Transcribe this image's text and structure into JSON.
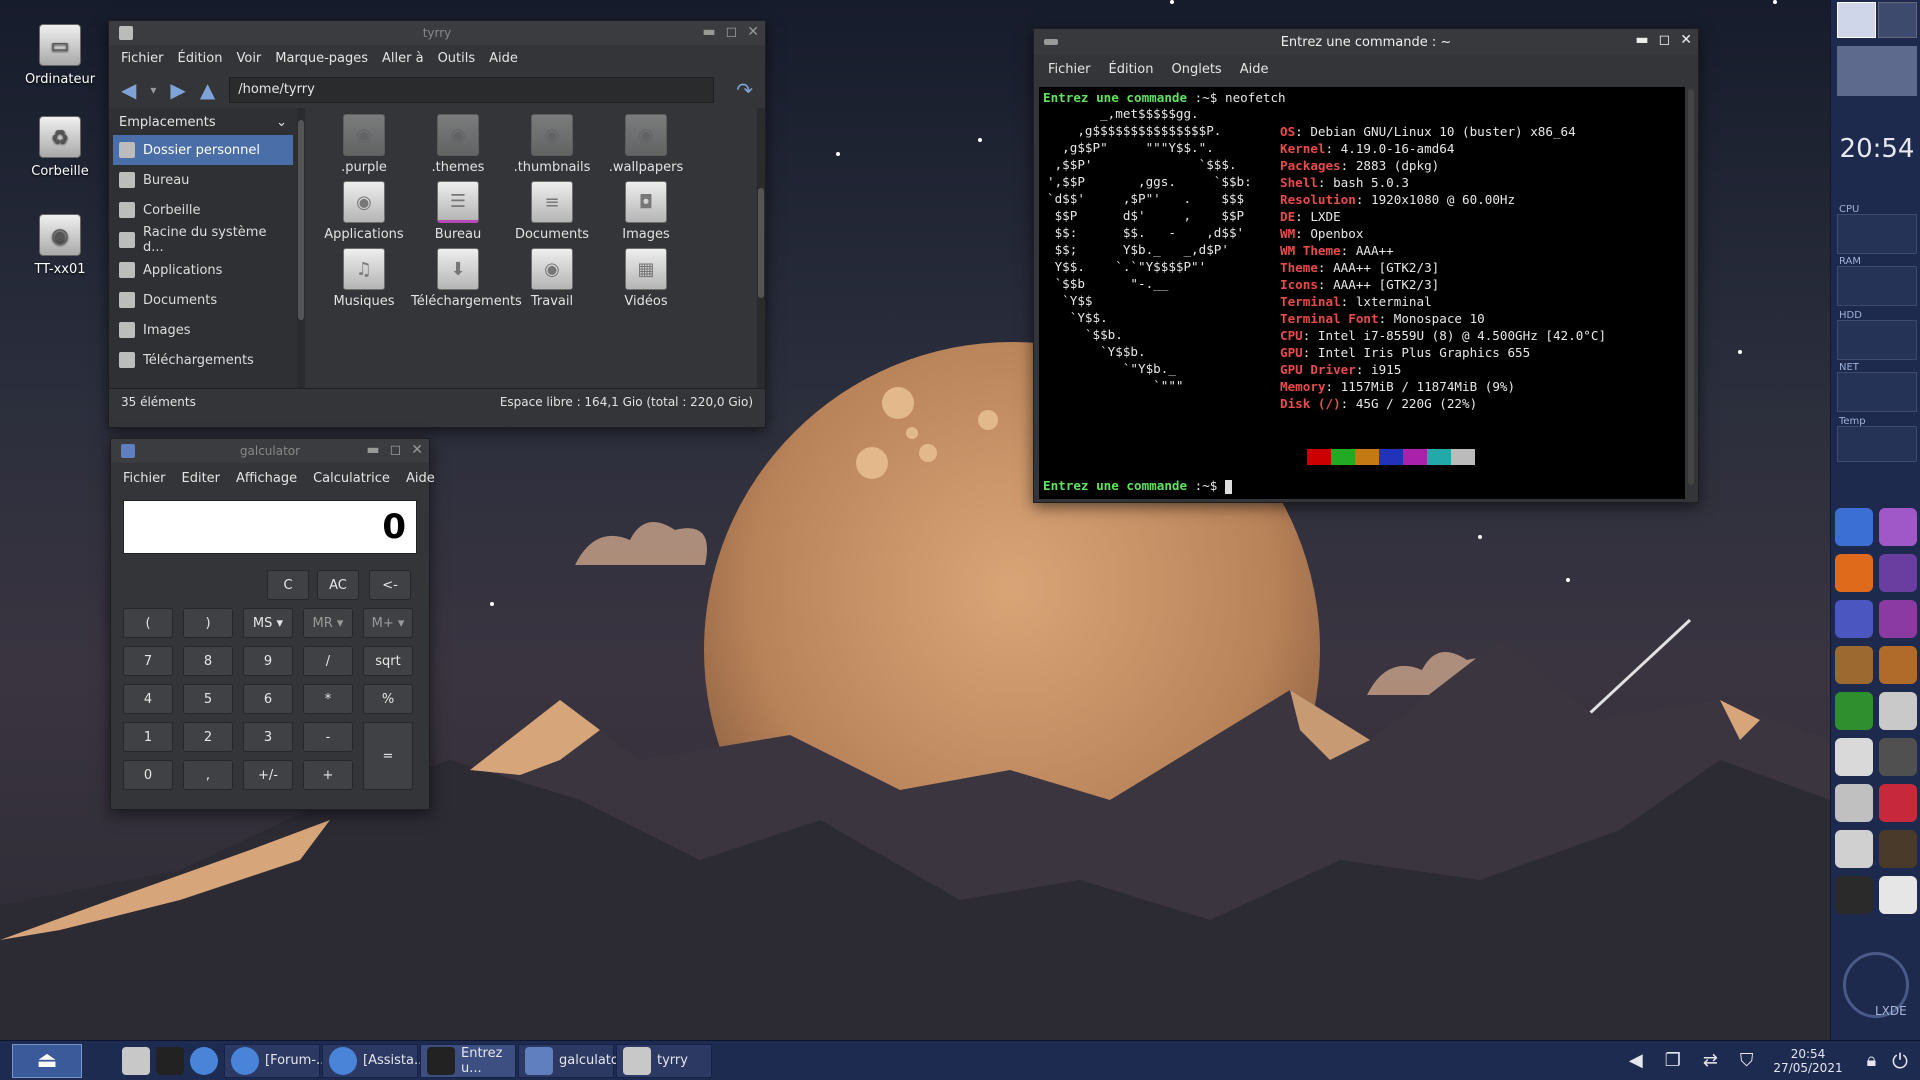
{
  "desktop_icons": [
    {
      "label": "Ordinateur",
      "icon": "computer-icon"
    },
    {
      "label": "Corbeille",
      "icon": "trash-icon"
    },
    {
      "label": "TT-xx01",
      "icon": "drive-icon"
    }
  ],
  "file_manager": {
    "title": "tyrry",
    "menu": [
      "Fichier",
      "Édition",
      "Voir",
      "Marque-pages",
      "Aller à",
      "Outils",
      "Aide"
    ],
    "path": "/home/tyrry",
    "sidebar_header": "Emplacements",
    "sidebar_items": [
      {
        "label": "Dossier personnel",
        "selected": true
      },
      {
        "label": "Bureau",
        "selected": false
      },
      {
        "label": "Corbeille",
        "selected": false
      },
      {
        "label": "Racine du système d...",
        "selected": false
      },
      {
        "label": "Applications",
        "selected": false
      },
      {
        "label": "Documents",
        "selected": false
      },
      {
        "label": "Images",
        "selected": false
      },
      {
        "label": "Téléchargements",
        "selected": false
      }
    ],
    "files": [
      {
        "name": ".purple",
        "hidden": true
      },
      {
        "name": ".themes",
        "hidden": true
      },
      {
        "name": ".thumbnails",
        "hidden": true
      },
      {
        "name": ".wallpapers",
        "hidden": true
      },
      {
        "name": "Applications",
        "hidden": false
      },
      {
        "name": "Bureau",
        "hidden": false
      },
      {
        "name": "Documents",
        "hidden": false
      },
      {
        "name": "Images",
        "hidden": false
      },
      {
        "name": "Musiques",
        "hidden": false
      },
      {
        "name": "Téléchargements",
        "hidden": false
      },
      {
        "name": "Travail",
        "hidden": false
      },
      {
        "name": "Vidéos",
        "hidden": false
      }
    ],
    "status_left": "35 éléments",
    "status_right": "Espace libre : 164,1 Gio (total : 220,0 Gio)"
  },
  "calculator": {
    "title": "galculator",
    "menu": [
      "Fichier",
      "Editer",
      "Affichage",
      "Calculatrice",
      "Aide"
    ],
    "display": "0",
    "buttons": [
      {
        "label": "C"
      },
      {
        "label": "AC"
      },
      {
        "label": "<-"
      },
      {
        "label": "("
      },
      {
        "label": ")"
      },
      {
        "label": "MS ▾"
      },
      {
        "label": "MR ▾"
      },
      {
        "label": "M+ ▾"
      },
      {
        "label": "7"
      },
      {
        "label": "8"
      },
      {
        "label": "9"
      },
      {
        "label": "/"
      },
      {
        "label": "sqrt"
      },
      {
        "label": "4"
      },
      {
        "label": "5"
      },
      {
        "label": "6"
      },
      {
        "label": "*"
      },
      {
        "label": "%"
      },
      {
        "label": "1"
      },
      {
        "label": "2"
      },
      {
        "label": "3"
      },
      {
        "label": "-"
      },
      {
        "label": "="
      },
      {
        "label": "0"
      },
      {
        "label": ","
      },
      {
        "label": "+/-"
      },
      {
        "label": "+"
      }
    ]
  },
  "terminal": {
    "title": "Entrez une commande : ~",
    "menu": [
      "Fichier",
      "Édition",
      "Onglets",
      "Aide"
    ],
    "prompt_user": "Entrez une commande",
    "prompt_path": " :~$ ",
    "command": "neofetch",
    "logo_lines": [
      "       _,met$$$$$gg.",
      "    ,g$$$$$$$$$$$$$$$P.",
      "  ,g$$P\"     \"\"\"Y$$.\".",
      " ,$$P'              `$$$.",
      "',$$P       ,ggs.     `$$b:",
      "`d$$'     ,$P\"'   .    $$$",
      " $$P      d$'     ,    $$P",
      " $$:      $$.   -    ,d$$'",
      " $$;      Y$b._   _,d$P'",
      " Y$$.    `.`\"Y$$$$P\"'",
      " `$$b      \"-.__",
      "  `Y$$",
      "   `Y$$.",
      "     `$$b.",
      "       `Y$$b.",
      "          `\"Y$b._",
      "              `\"\"\""
    ],
    "info": [
      {
        "key": "OS",
        "value": "Debian GNU/Linux 10 (buster) x86_64"
      },
      {
        "key": "Kernel",
        "value": "4.19.0-16-amd64"
      },
      {
        "key": "Packages",
        "value": "2883 (dpkg)"
      },
      {
        "key": "Shell",
        "value": "bash 5.0.3"
      },
      {
        "key": "Resolution",
        "value": "1920x1080 @ 60.00Hz"
      },
      {
        "key": "DE",
        "value": "LXDE"
      },
      {
        "key": "WM",
        "value": "Openbox"
      },
      {
        "key": "WM Theme",
        "value": "AAA++"
      },
      {
        "key": "Theme",
        "value": "AAA++ [GTK2/3]"
      },
      {
        "key": "Icons",
        "value": "AAA++ [GTK2/3]"
      },
      {
        "key": "Terminal",
        "value": "lxterminal"
      },
      {
        "key": "Terminal Font",
        "value": "Monospace 10"
      },
      {
        "key": "CPU",
        "value": "Intel i7-8559U (8) @ 4.500GHz [42.0°C]"
      },
      {
        "key": "GPU",
        "value": "Intel Iris Plus Graphics 655"
      },
      {
        "key": "GPU Driver",
        "value": "i915"
      },
      {
        "key": "Memory",
        "value": "1157MiB / 11874MiB (9%)"
      },
      {
        "key": "Disk (/)",
        "value": "45G / 220G (22%)"
      }
    ],
    "palette": [
      "#cc0000",
      "#22aa22",
      "#c47a12",
      "#2233bb",
      "#aa22aa",
      "#22aaaa",
      "#bbbbbb"
    ]
  },
  "dock": {
    "clock": "20:54",
    "monitors": [
      "CPU",
      "RAM",
      "HDD",
      "NET",
      "Temp"
    ],
    "logo_text": "LXDE",
    "apps": [
      {
        "icon": "chromium-icon",
        "color": "#3b6fd4"
      },
      {
        "icon": "bird-icon",
        "color": "#a058c8"
      },
      {
        "icon": "firefox-icon",
        "color": "#e06a1c"
      },
      {
        "icon": "image-viewer-icon",
        "color": "#6a3da0"
      },
      {
        "icon": "teams-icon",
        "color": "#4b56c0"
      },
      {
        "icon": "pidgin-icon",
        "color": "#8a3aa0"
      },
      {
        "icon": "gimp-icon",
        "color": "#9c6a30"
      },
      {
        "icon": "inkscape-icon",
        "color": "#b06b2a"
      },
      {
        "icon": "color-picker-icon",
        "color": "#2f8f2f"
      },
      {
        "icon": "calculator-icon",
        "color": "#c9c9c9"
      },
      {
        "icon": "text-editor-icon",
        "color": "#d9d9d9"
      },
      {
        "icon": "camera-icon",
        "color": "#505050"
      },
      {
        "icon": "mixer-icon",
        "color": "#c0c0c0"
      },
      {
        "icon": "debian-icon",
        "color": "#c8283c"
      },
      {
        "icon": "drive-icon",
        "color": "#d0d0d0"
      },
      {
        "icon": "system-monitor-icon",
        "color": "#4a3a2a"
      },
      {
        "icon": "terminal-icon",
        "color": "#2a2a2a"
      },
      {
        "icon": "menu-icon",
        "color": "#e6e6e6"
      }
    ]
  },
  "taskbar": {
    "items": [
      {
        "label": "",
        "icon": "menu-icon"
      },
      {
        "label": "",
        "icon": "file-manager-icon"
      },
      {
        "label": "",
        "icon": "terminal-icon"
      },
      {
        "label": "",
        "icon": "chromium-icon"
      },
      {
        "label": "[Forum-...",
        "icon": "chromium-icon"
      },
      {
        "label": "[Assista...",
        "icon": "chromium-icon"
      },
      {
        "label": "Entrez u...",
        "icon": "terminal-icon"
      },
      {
        "label": "galculator",
        "icon": "calculator-icon"
      },
      {
        "label": "tyrry",
        "icon": "folder-icon"
      }
    ],
    "time": "20:54",
    "date": "27/05/2021"
  }
}
